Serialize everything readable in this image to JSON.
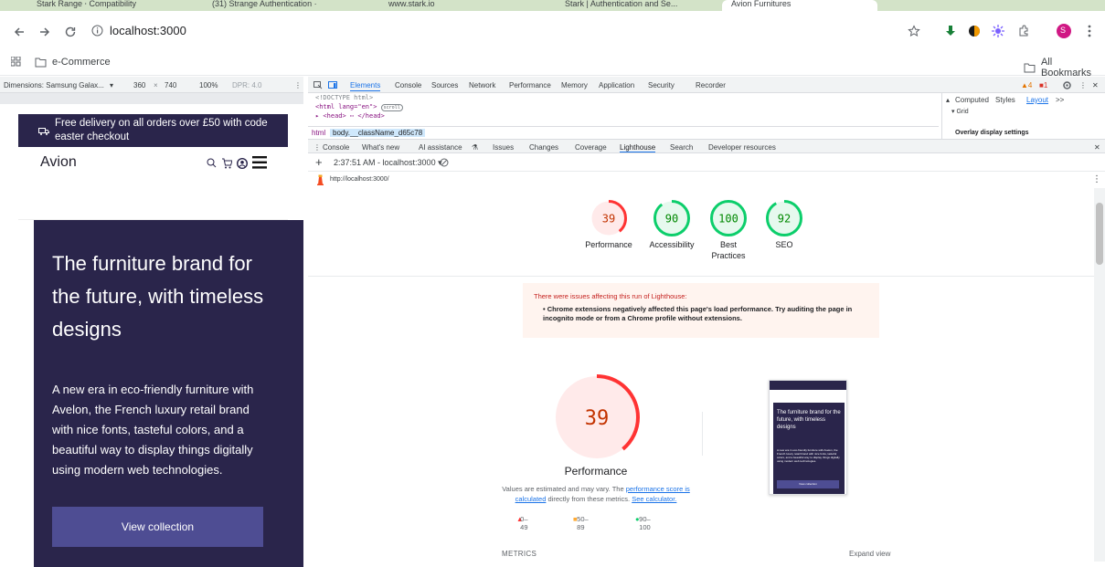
{
  "browser": {
    "tabs": [
      {
        "label": "Stark Range ⸱ Compatibility"
      },
      {
        "label": "(31) Strange Authentication ·"
      },
      {
        "label": "www.stark.io"
      },
      {
        "label": "Stark | Authentication and Se..."
      },
      {
        "label": "Avion Furnitures"
      }
    ],
    "url": "localhost:3000",
    "profile_initial": "S",
    "bookmarks": {
      "folder": "e-Commerce",
      "all": "All Bookmarks"
    }
  },
  "device_toolbar": {
    "dimensions": "Dimensions: Samsung Galax...",
    "width": "360",
    "times": "×",
    "height": "740",
    "zoom": "100%",
    "dpr": "DPR: 4.0"
  },
  "site": {
    "promo": "Free delivery on all orders over £50 with code easter checkout",
    "logo": "Avion",
    "hero_title": "The furniture brand for the future, with timeless designs",
    "hero_body": "A new era in eco-friendly furniture with Avelon, the French luxury retail brand with nice fonts, tasteful colors, and a beautiful way to display things digitally using modern web technologies.",
    "cta": "View collection"
  },
  "devtools": {
    "tabs": [
      "Elements",
      "Console",
      "Sources",
      "Network",
      "Performance",
      "Memory",
      "Application",
      "Security",
      "Recorder"
    ],
    "warnings": "4",
    "errors": "1",
    "elements_lines": [
      "<!DOCTYPE html>",
      "<html lang=\"en\">",
      "▸ <head> ⋯ </head>"
    ],
    "scroll_badge": "scroll",
    "crumbs": [
      "html",
      "body.__className_d65c78"
    ],
    "side_tabs": [
      "Computed",
      "Styles",
      "Layout",
      ">>"
    ],
    "side_grid": "▾ Grid",
    "side_overlay": "Overlay display settings",
    "drawer_tabs": [
      "Console",
      "What's new",
      "AI assistance",
      "Issues",
      "Changes",
      "Coverage",
      "Lighthouse",
      "Search",
      "Developer resources"
    ],
    "lh_time": "2:37:51 AM - localhost:3000 ▾",
    "lh_url": "http://localhost:3000/"
  },
  "lighthouse": {
    "scores": [
      {
        "value": 39,
        "label": "Performance",
        "color": "#ff3333"
      },
      {
        "value": 90,
        "label": "Accessibility",
        "color": "#0cce6b"
      },
      {
        "value": 100,
        "label": "Best Practices",
        "color": "#0cce6b"
      },
      {
        "value": 92,
        "label": "SEO",
        "color": "#0cce6b"
      }
    ],
    "warning_head": "There were issues affecting this run of Lighthouse:",
    "warning_item": "Chrome extensions negatively affected this page's load performance. Try auditing the page in incognito mode or from a Chrome profile without extensions.",
    "perf_title": "Performance",
    "perf_note_1": "Values are estimated and may vary. The",
    "perf_note_link1": "performance score is calculated",
    "perf_note_2": "directly from these metrics.",
    "perf_note_link2": "See calculator.",
    "legend": [
      {
        "range": "0–49",
        "color": "#ff3333"
      },
      {
        "range": "50–89",
        "color": "#ffaa33"
      },
      {
        "range": "90–100",
        "color": "#0cce6b"
      }
    ],
    "metrics_label": "METRICS",
    "expand_label": "Expand view",
    "thumb_title": "The furniture brand for the future, with timeless designs",
    "thumb_body": "A new era in eco-friendly furniture with Avelon, the French luxury retail brand with nice fonts, tasteful colors, and a beautiful way to display things digitally using modern web technologies.",
    "thumb_cta": "View collection"
  }
}
